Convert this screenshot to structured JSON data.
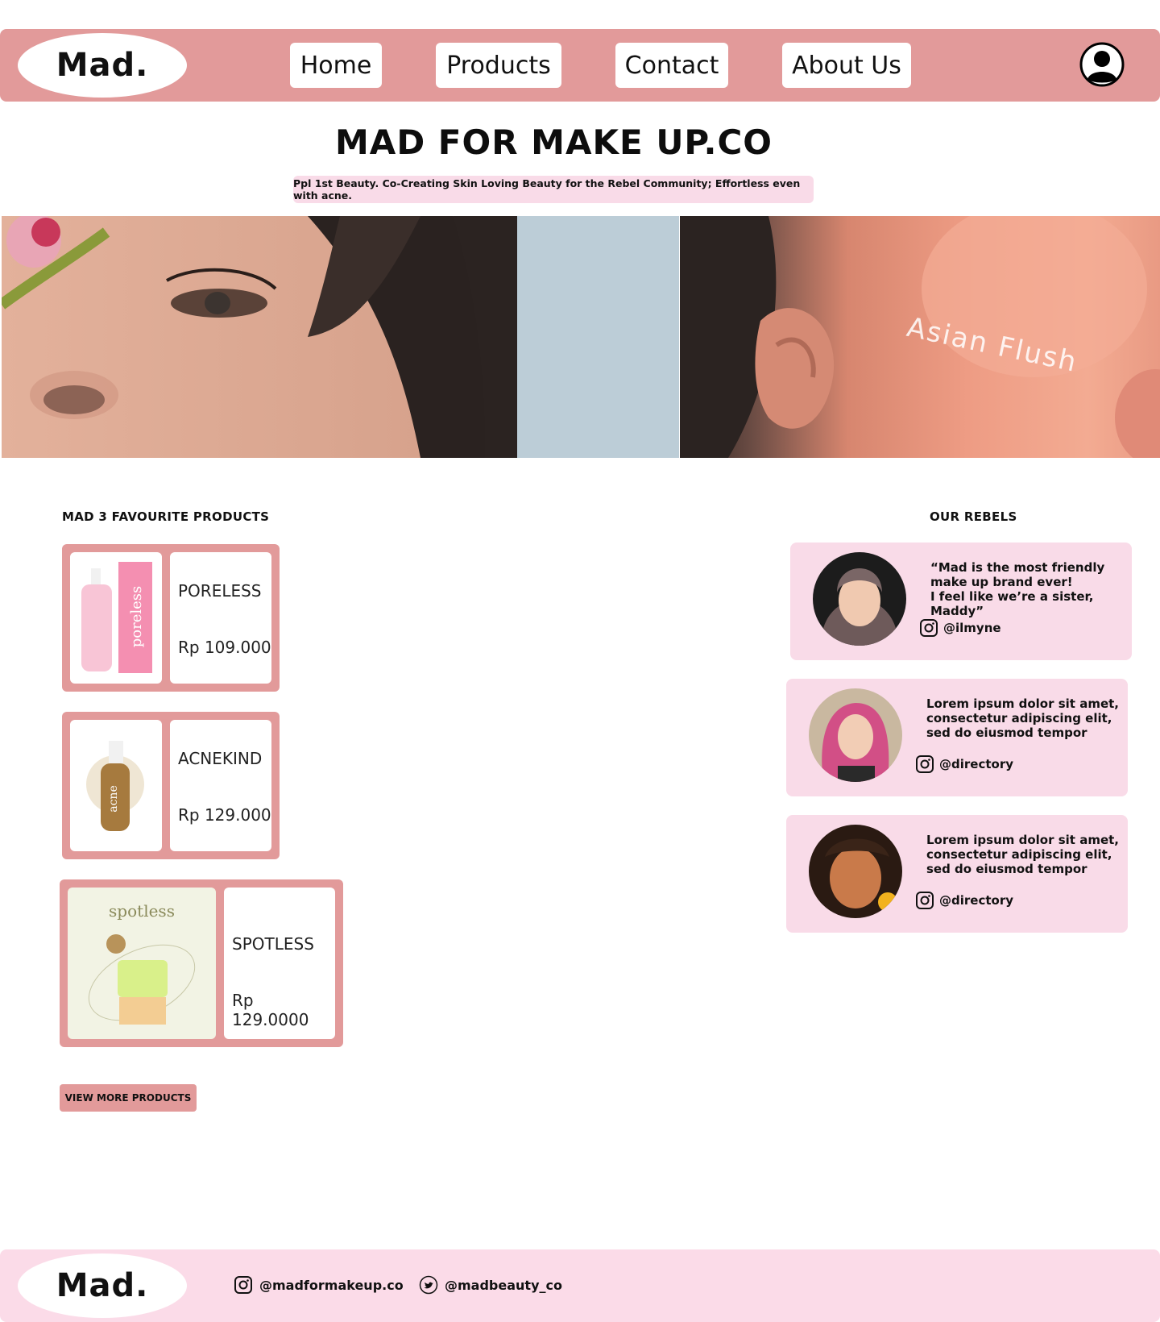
{
  "brand": {
    "logo": "Mad."
  },
  "nav": {
    "items": [
      {
        "label": "Home"
      },
      {
        "label": "Products"
      },
      {
        "label": "Contact"
      },
      {
        "label": "About Us"
      }
    ],
    "profile_icon": "user-circle-icon"
  },
  "hero": {
    "title": "MAD FOR MAKE UP.CO",
    "tagline": "Ppl 1st Beauty. Co-Creating Skin Loving Beauty for the Rebel Community; Effortless even with acne.",
    "overlay_text": "Asian Flush"
  },
  "favourites": {
    "heading": "MAD 3 FAVOURITE PRODUCTS",
    "products": [
      {
        "name": "PORELESS",
        "price": "Rp 109.000",
        "image_text": "poreless"
      },
      {
        "name": "ACNEKIND",
        "price": "Rp 129.000",
        "image_text": "acne"
      },
      {
        "name": "SPOTLESS",
        "price": "Rp 129.0000",
        "image_text": "spotless"
      }
    ],
    "button": "VIEW MORE PRODUCTS"
  },
  "rebels": {
    "heading": "OUR REBELS",
    "items": [
      {
        "quote": "“Mad is the most friendly\nmake up brand ever!\nI feel like we’re a sister, Maddy”",
        "handle": "@ilmyne"
      },
      {
        "quote": "Lorem ipsum dolor sit amet,\nconsectetur adipiscing elit,\nsed do eiusmod tempor",
        "handle": "@directory"
      },
      {
        "quote": "Lorem ipsum dolor sit amet,\nconsectetur adipiscing elit,\nsed do eiusmod tempor",
        "handle": "@directory"
      }
    ]
  },
  "footer": {
    "logo": "Mad.",
    "instagram": "@madformakeup.co",
    "twitter": "@madbeauty_co"
  },
  "colors": {
    "accent": "#e29a9a",
    "soft_pink": "#f9dbe8",
    "text": "#111111"
  }
}
